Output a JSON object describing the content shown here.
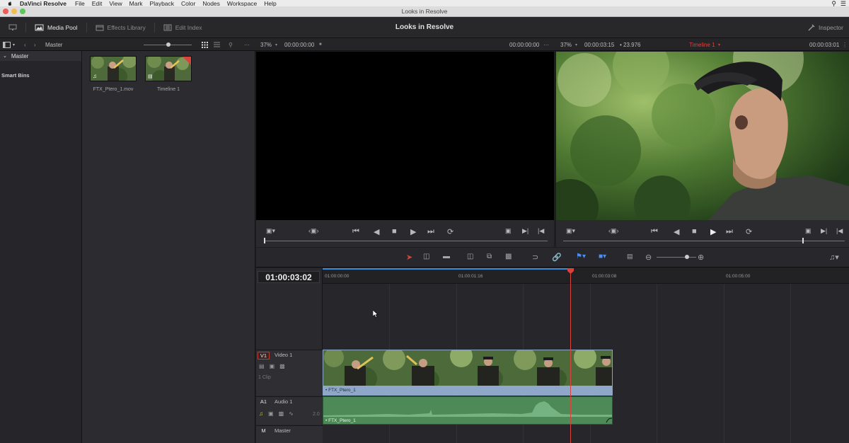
{
  "menubar": {
    "app_name": "DaVinci Resolve",
    "items": [
      "File",
      "Edit",
      "View",
      "Mark",
      "Playback",
      "Color",
      "Nodes",
      "Workspace",
      "Help"
    ]
  },
  "window": {
    "title": "Looks in Resolve"
  },
  "toolbar": {
    "media_pool": "Media Pool",
    "effects_library": "Effects Library",
    "edit_index": "Edit Index",
    "project_title": "Looks in Resolve",
    "inspector": "Inspector"
  },
  "subbar": {
    "bin_name": "Master",
    "source_zoom": "37%",
    "source_timecode": "00:00:00:00",
    "source_duration": "00:00:00:00",
    "timeline_zoom": "37%",
    "timeline_duration": "00:00:03:15",
    "frame_rate": "23.976",
    "timeline_name": "Timeline 1",
    "timeline_timecode": "00:00:03:01"
  },
  "bins": {
    "master": "Master",
    "smart_bins": "Smart Bins"
  },
  "media_pool": {
    "clips": [
      {
        "name": "FTX_Ptero_1.mov",
        "type": "audio-video"
      },
      {
        "name": "Timeline 1",
        "type": "timeline"
      }
    ]
  },
  "timeline": {
    "timecode": "01:00:03:02",
    "ruler": [
      "01:00:00:00",
      "01:00:01:16",
      "01:00:03:08",
      "01:00:05:00"
    ],
    "tracks": {
      "video": {
        "tag": "V1",
        "name": "Video 1",
        "clip_count": "1 Clip"
      },
      "audio": {
        "tag": "A1",
        "name": "Audio 1",
        "level": "2.0"
      },
      "master": {
        "tag": "M",
        "name": "Master"
      }
    },
    "video_clip_label": "FTX_Ptero_1",
    "audio_clip_label": "FTX_Ptero_1"
  },
  "colors": {
    "playhead": "#d9433b",
    "video_clip": "#8fa8c9",
    "audio_clip": "#4d8a57",
    "accent_blue": "#3a8ad8"
  }
}
